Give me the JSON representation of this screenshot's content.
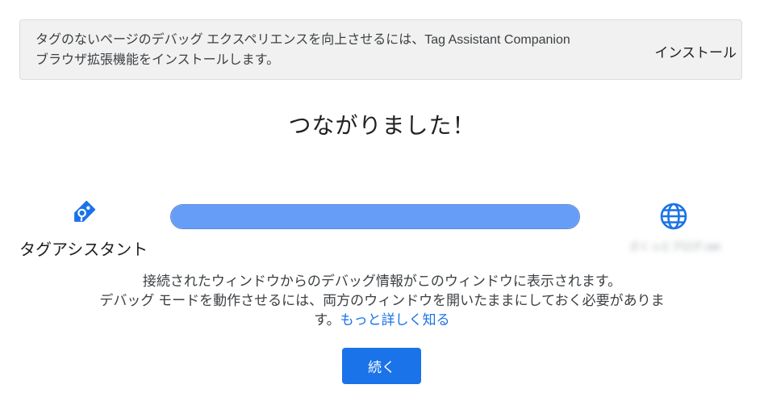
{
  "banner": {
    "message": "タグのないページのデバッグ エクスペリエンスを向上させるには、Tag Assistant Companion ブラウザ拡張機能をインストールします。",
    "install_label": "インストール"
  },
  "title": "つながりました！",
  "connection": {
    "left_label": "タグアシスタント",
    "right_label": "さくっとブログ.net",
    "progress_percent": 100
  },
  "description": {
    "line1": "接続されたウィンドウからのデバッグ情報がこのウィンドウに表示されます。",
    "line2": "デバッグ モードを動作させるには、両方のウィンドウを開いたままにしておく必要があります。",
    "learn_more_label": "もっと詳しく知る"
  },
  "continue_label": "続く",
  "colors": {
    "accent": "#1a73e8",
    "progress_fill": "#669df6",
    "banner_bg": "#f1f1f1"
  },
  "icons": {
    "left": "tag-assistant-icon",
    "right": "globe-icon"
  }
}
